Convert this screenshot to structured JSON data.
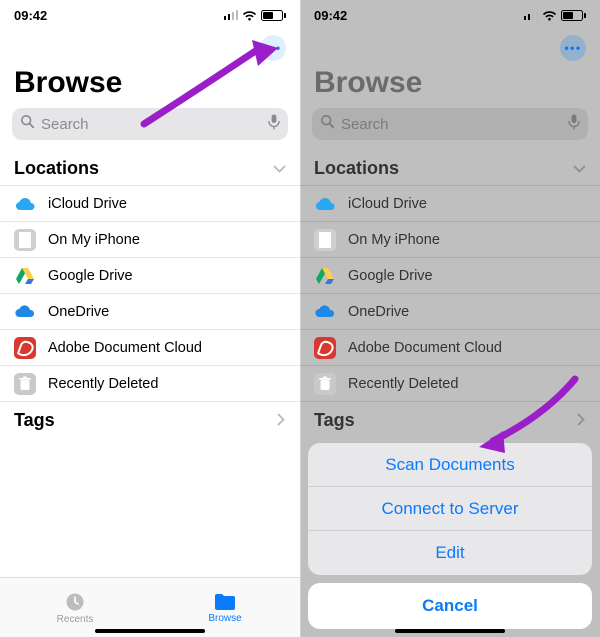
{
  "statusbar": {
    "time": "09:42"
  },
  "topbar": {
    "more_label": "•••"
  },
  "title": "Browse",
  "search": {
    "placeholder": "Search"
  },
  "locations": {
    "header": "Locations",
    "items": [
      {
        "label": "iCloud Drive",
        "icon": "cloud"
      },
      {
        "label": "On My iPhone",
        "icon": "phone"
      },
      {
        "label": "Google Drive",
        "icon": "gdrive"
      },
      {
        "label": "OneDrive",
        "icon": "onedrive"
      },
      {
        "label": "Adobe Document Cloud",
        "icon": "acrobat"
      },
      {
        "label": "Recently Deleted",
        "icon": "trash"
      }
    ]
  },
  "tags": {
    "header": "Tags"
  },
  "tabbar": {
    "recents": "Recents",
    "browse": "Browse"
  },
  "actionsheet": {
    "options": [
      "Scan Documents",
      "Connect to Server",
      "Edit"
    ],
    "cancel": "Cancel"
  }
}
